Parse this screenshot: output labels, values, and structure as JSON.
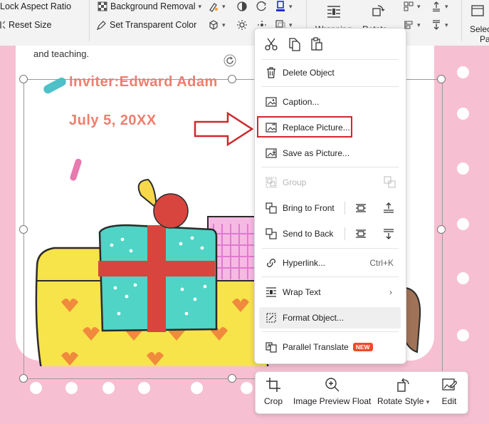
{
  "ribbon": {
    "lock_aspect_ratio": "Lock Aspect Ratio",
    "reset_size": "Reset Size",
    "background_removal": "Background Removal",
    "set_transparent_color": "Set Transparent Color",
    "wrapping": "Wrapping",
    "rotate": "Rotate",
    "selection_pane_1": "Selectio",
    "selection_pane_2": "Pane"
  },
  "document": {
    "snippet": "and teaching.",
    "inviter": "Inviter:Edward Adam",
    "date": "July 5, 20XX"
  },
  "context_menu": {
    "delete_object": "Delete Object",
    "caption": "Caption...",
    "replace_picture": "Replace Picture...",
    "save_as_picture": "Save as Picture...",
    "group": "Group",
    "bring_to_front": "Bring to Front",
    "send_to_back": "Send to Back",
    "hyperlink": "Hyperlink...",
    "hyperlink_shortcut": "Ctrl+K",
    "wrap_text": "Wrap Text",
    "format_object": "Format Object...",
    "parallel_translate": "Parallel Translate",
    "new_badge": "NEW"
  },
  "toolbar": {
    "crop": "Crop",
    "image_preview_float": "Image Preview Float",
    "rotate_style": "Rotate Style",
    "edit": "Edit"
  },
  "colors": {
    "accent_red": "#d0282e",
    "title_coral": "#ee7e6e",
    "background_pink": "#f7bfd2"
  }
}
